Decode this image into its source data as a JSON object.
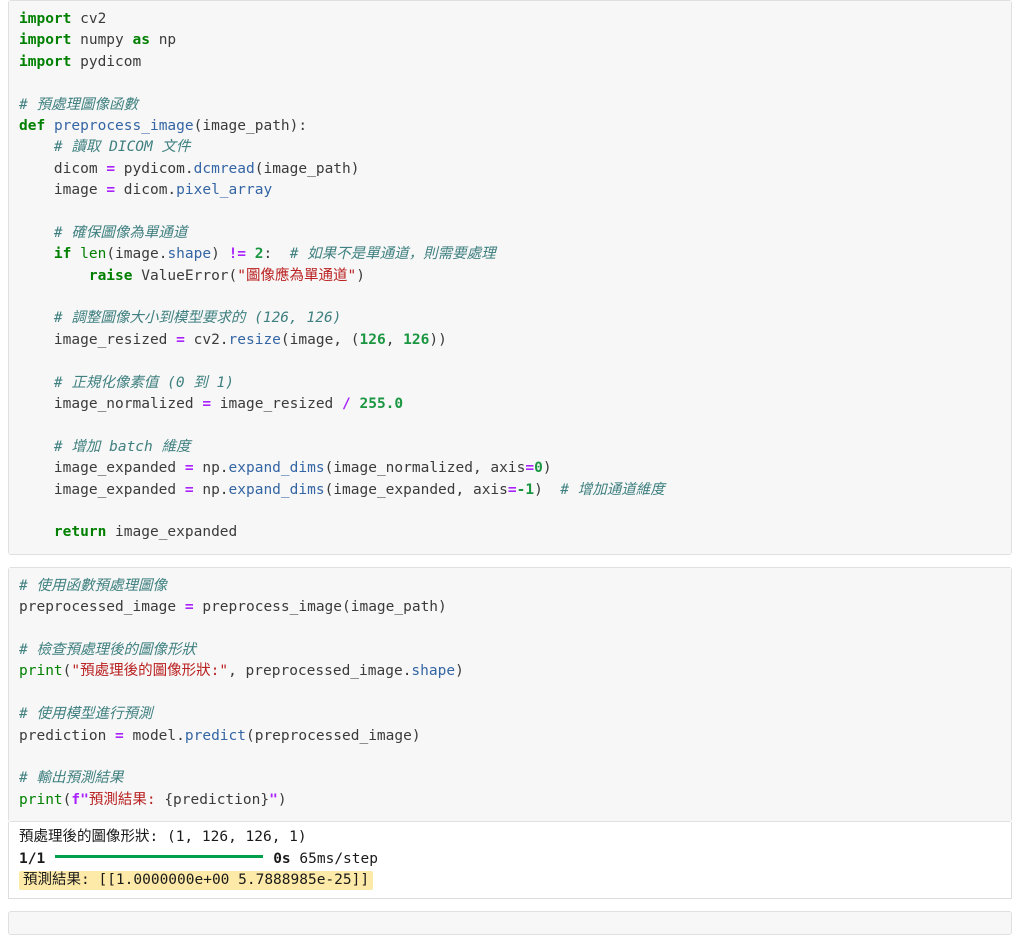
{
  "notebook": {
    "theme": {
      "page_background": "#ffffff",
      "cell_background": "#f7f7f7",
      "cell_border": "#e0e0e0",
      "keyword_color": "#008000",
      "function_color": "#3465a4",
      "string_color": "#ba2121",
      "comment_color": "#408080",
      "operator_color": "#aa22ff",
      "number_color": "#1a9641",
      "highlight_color": "#fdeaa8",
      "progress_bar_color": "#00a04a"
    },
    "cells": [
      {
        "id": "cell-1",
        "type": "code",
        "lines": [
          "import cv2",
          "import numpy as np",
          "import pydicom",
          "",
          "# 預處理圖像函數",
          "def preprocess_image(image_path):",
          "    # 讀取 DICOM 文件",
          "    dicom = pydicom.dcmread(image_path)",
          "    image = dicom.pixel_array",
          "",
          "    # 確保圖像為單通道",
          "    if len(image.shape) != 2:  # 如果不是單通道，則需要處理",
          "        raise ValueError(\"圖像應為單通道\")",
          "",
          "    # 調整圖像大小到模型要求的 (126, 126)",
          "    image_resized = cv2.resize(image, (126, 126))",
          "",
          "    # 正規化像素值 (0 到 1)",
          "    image_normalized = image_resized / 255.0",
          "",
          "    # 增加 batch 維度",
          "    image_expanded = np.expand_dims(image_normalized, axis=0)",
          "    image_expanded = np.expand_dims(image_expanded, axis=-1)  # 增加通道維度",
          "",
          "    return image_expanded"
        ]
      },
      {
        "id": "cell-2",
        "type": "code",
        "lines": [
          "# 使用函數預處理圖像",
          "preprocessed_image = preprocess_image(image_path)",
          "",
          "# 檢查預處理後的圖像形狀",
          "print(\"預處理後的圖像形狀:\", preprocessed_image.shape)",
          "",
          "# 使用模型進行預測",
          "prediction = model.predict(preprocessed_image)",
          "",
          "# 輸出預測結果",
          "print(f\"預測結果: {prediction}\")"
        ],
        "output": {
          "shape_line": "預處理後的圖像形狀: (1, 126, 126, 1)",
          "progress_steps": "1/1",
          "progress_time": "0s",
          "progress_rate": "65ms/step",
          "result_line": "預測結果: [[1.0000000e+00 5.7888985e-25]]"
        }
      },
      {
        "id": "cell-3",
        "type": "code",
        "lines": []
      }
    ]
  }
}
